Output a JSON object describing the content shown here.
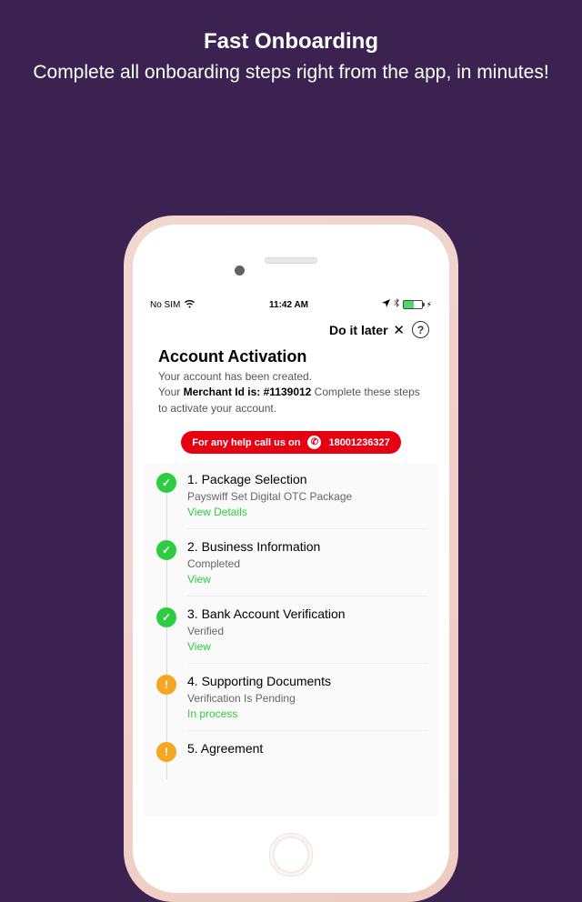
{
  "promo": {
    "title": "Fast Onboarding",
    "subtitle": "Complete all onboarding steps right from the app, in minutes!"
  },
  "status_bar": {
    "carrier": "No SIM",
    "time": "11:42 AM",
    "bluetooth": "✱",
    "battery_charging": "⚡︎"
  },
  "header": {
    "do_later": "Do it later",
    "close": "✕",
    "help": "?"
  },
  "activation": {
    "heading": "Account Activation",
    "line1": "Your account has been created.",
    "your_prefix": "Your ",
    "merchant_label": "Merchant Id is: #1139012",
    "complete_suffix": " Complete these steps to activate your account."
  },
  "help_pill": {
    "text": "For any help call us on",
    "phone_icon": "✆",
    "number": "18001236327"
  },
  "steps": [
    {
      "badge": "done",
      "check": "✓",
      "title": "1. Package Selection",
      "status": "Payswiff Set Digital OTC Package",
      "link": "View Details"
    },
    {
      "badge": "done",
      "check": "✓",
      "title": "2. Business Information",
      "status": "Completed",
      "link": "View"
    },
    {
      "badge": "done",
      "check": "✓",
      "title": "3. Bank Account Verification",
      "status": "Verified",
      "link": "View"
    },
    {
      "badge": "warn",
      "check": "!",
      "title": "4. Supporting Documents",
      "status": "Verification Is Pending",
      "link": "In process"
    },
    {
      "badge": "warn",
      "check": "!",
      "title": "5. Agreement",
      "status": "",
      "link": ""
    }
  ]
}
